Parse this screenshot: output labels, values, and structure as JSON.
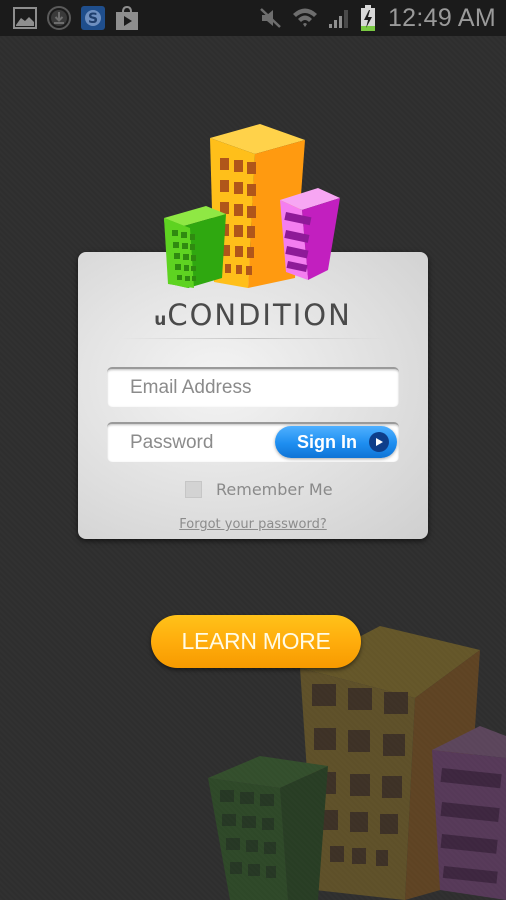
{
  "status_bar": {
    "left_icons": [
      "gallery-icon",
      "download-icon",
      "skype-icon",
      "play-store-icon"
    ],
    "right_icons": [
      "mute-icon",
      "wifi-icon",
      "signal-icon",
      "battery-charging-icon"
    ],
    "time": "12:49 AM"
  },
  "login_card": {
    "brand_prefix": "u",
    "brand_name": "CONDITION",
    "email_placeholder": "Email Address",
    "email_value": "",
    "password_placeholder": "Password",
    "password_value": "",
    "sign_in_label": "Sign In",
    "remember_label": "Remember Me",
    "remember_checked": false,
    "forgot_label": "Forgot your password?"
  },
  "learn_more_label": "LEARN MORE",
  "colors": {
    "accent_blue": "#1e8ef0",
    "accent_orange": "#ffad0c",
    "building_green": "#5ed321",
    "building_yellow": "#ffbf1a",
    "building_pink": "#f47ef0"
  }
}
